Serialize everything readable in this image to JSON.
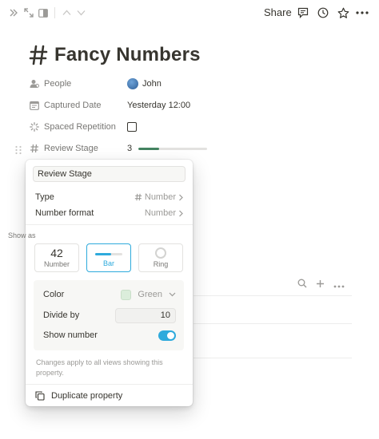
{
  "topbar": {
    "share_label": "Share",
    "icons": [
      "double-chevron-right-icon",
      "expand-icon",
      "sidebar-panel-icon",
      "chevron-up-icon",
      "chevron-down-icon",
      "comment-icon",
      "clock-icon",
      "star-icon",
      "more-icon"
    ]
  },
  "page": {
    "title": "Fancy Numbers",
    "properties": [
      {
        "label": "People",
        "value": "John",
        "icon": "person-icon"
      },
      {
        "label": "Captured Date",
        "value": "Yesterday 12:00",
        "icon": "calendar-icon"
      },
      {
        "label": "Spaced Repetition",
        "value": "",
        "icon": "loading-icon"
      },
      {
        "label": "Review Stage",
        "value": "3",
        "icon": "hash-icon",
        "progress": 0.3
      }
    ]
  },
  "popover": {
    "name_value": "Review Stage",
    "type_label": "Type",
    "type_value": "Number",
    "format_label": "Number format",
    "format_value": "Number",
    "show_as_label": "Show as",
    "show_as_options": [
      {
        "preview": "42",
        "label": "Number"
      },
      {
        "preview": "",
        "label": "Bar",
        "selected": true
      },
      {
        "preview": "",
        "label": "Ring"
      }
    ],
    "color_label": "Color",
    "color_value": "Green",
    "color_hex": "#dbeddb",
    "divide_label": "Divide by",
    "divide_value": "10",
    "show_number_label": "Show number",
    "show_number_on": true,
    "note": "Changes apply to all views showing this property.",
    "duplicate_label": "Duplicate property"
  },
  "colors": {
    "accent": "#2eaadc",
    "progress_green": "#448361"
  }
}
